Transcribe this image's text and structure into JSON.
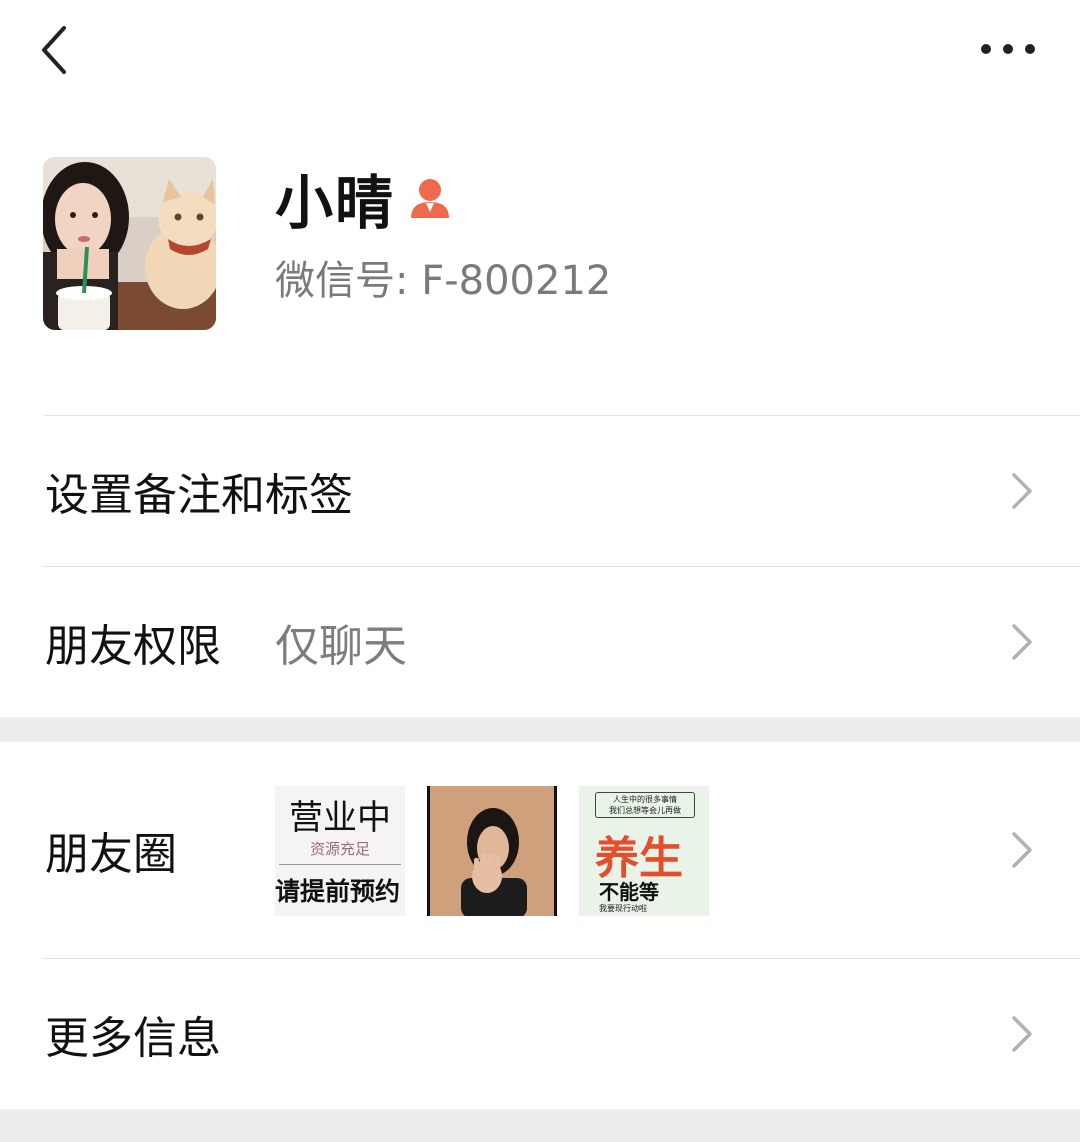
{
  "topbar": {
    "back_icon": "chevron-left-icon",
    "more_icon": "more-dots-icon"
  },
  "profile": {
    "name": "小晴",
    "wechat_id_label": "微信号:",
    "wechat_id": "F-800212",
    "badge_color": "#ee6a4e"
  },
  "rows": {
    "remark": {
      "label": "设置备注和标签"
    },
    "permission": {
      "label": "朋友权限",
      "value": "仅聊天"
    },
    "moments": {
      "label": "朋友圈",
      "thumbs": [
        {
          "line1": "营业中",
          "line2": "资源充足",
          "line3": "请提前预约"
        },
        {
          "caption": ""
        },
        {
          "top1": "人生中的很多事情",
          "top2": "我们总想等会儿再做",
          "big": "养生",
          "mid": "不能等",
          "small": "我要现行动啦"
        }
      ]
    },
    "more_info": {
      "label": "更多信息"
    }
  },
  "colors": {
    "divider": "#e3e3e3",
    "section_gap": "#ededed",
    "chevron": "#b2b2b2"
  }
}
